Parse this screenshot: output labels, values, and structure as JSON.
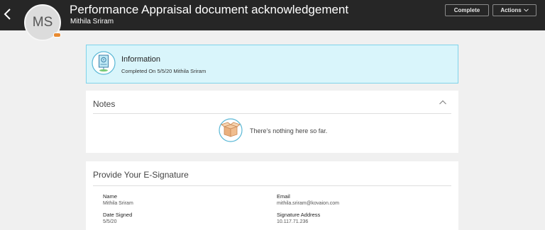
{
  "header": {
    "title": "Performance Appraisal document acknowledgement",
    "subtitle": "Mithila Sriram",
    "avatar_initials": "MS",
    "complete_label": "Complete",
    "actions_label": "Actions",
    "colors": {
      "bar": "#262626",
      "avatar_badge": "#e88a30"
    }
  },
  "info": {
    "title": "Information",
    "text": "Completed On 5/5/20 Mithila Sriram",
    "colors": {
      "background": "#d9f5fb",
      "border": "#7fd3ea"
    }
  },
  "notes": {
    "title": "Notes",
    "empty_text": "There's nothing here so far."
  },
  "signature": {
    "title": "Provide Your E-Signature",
    "fields": [
      {
        "label": "Name",
        "value": "Mithila Sriram"
      },
      {
        "label": "Email",
        "value": "mithila.sriram@kovaion.com"
      },
      {
        "label": "Date Signed",
        "value": "5/5/20"
      },
      {
        "label": "Signature Address",
        "value": "10.117.71.236"
      }
    ]
  }
}
